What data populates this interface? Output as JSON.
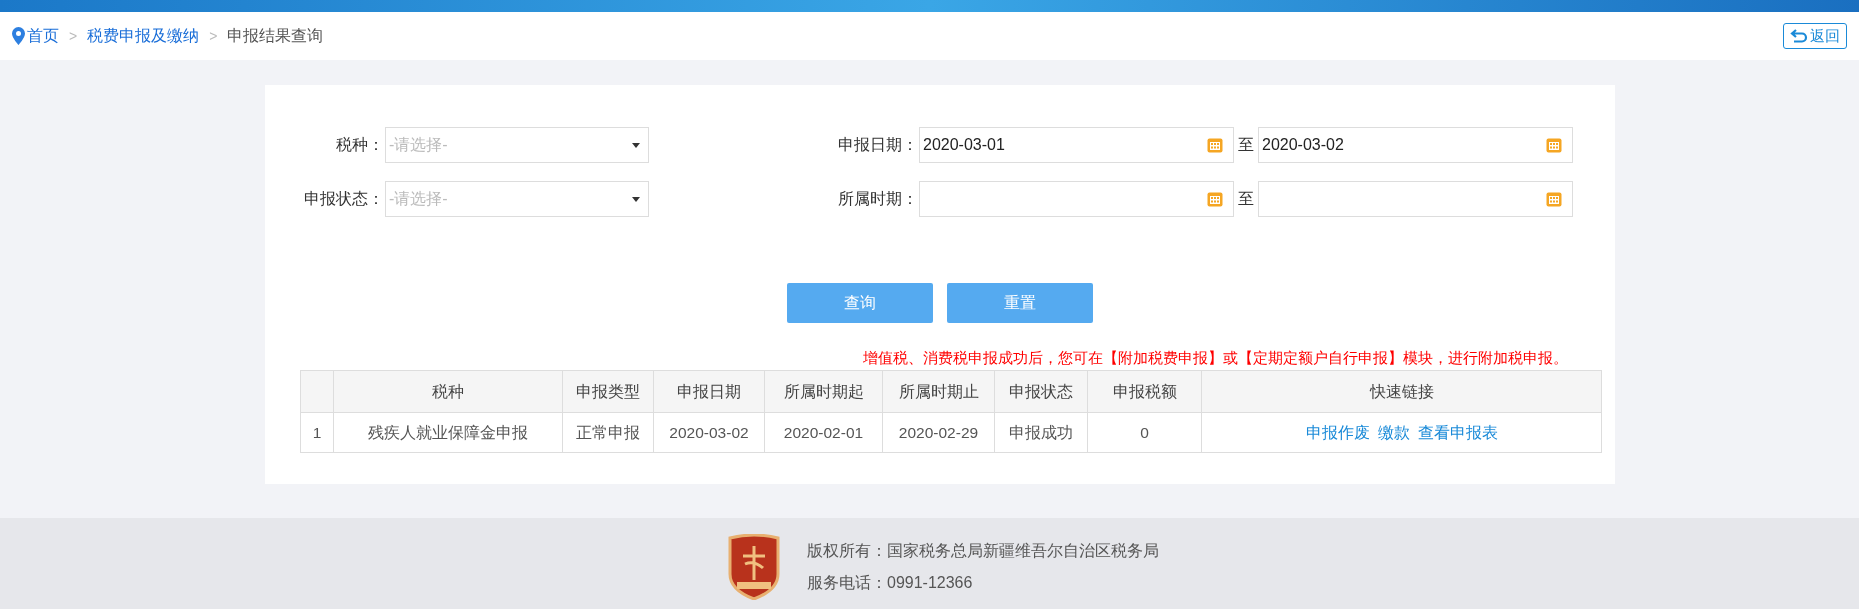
{
  "breadcrumb_separator": ">",
  "breadcrumb": [
    {
      "label": "首页",
      "kind": "home"
    },
    {
      "label": "税费申报及缴纳",
      "kind": "link"
    },
    {
      "label": "申报结果查询",
      "kind": "current"
    }
  ],
  "back_button": "返回",
  "filters": [
    {
      "label": "税种：",
      "kind": "select",
      "placeholder": "-请选择-"
    },
    {
      "label": "申报日期：",
      "kind": "range",
      "from": "2020-03-01",
      "separator": "至",
      "to": "2020-03-02"
    },
    {
      "label": "申报状态：",
      "kind": "select",
      "placeholder": "-请选择-"
    },
    {
      "label": "所属时期：",
      "kind": "range",
      "separator": "至"
    }
  ],
  "buttons": [
    "查询",
    "重置"
  ],
  "notice": "增值税、消费税申报成功后，您可在【附加税费申报】或【定期定额户自行申报】模块，进行附加税申报。",
  "table": {
    "columns": [
      "",
      "税种",
      "申报类型",
      "申报日期",
      "所属时期起",
      "所属时期止",
      "申报状态",
      "申报税额",
      "快速链接"
    ],
    "rows": [
      {
        "cells": [
          "1",
          "残疾人就业保障金申报",
          "正常申报",
          "2020-03-02",
          "2020-02-01",
          "2020-02-29",
          "申报成功",
          "0"
        ],
        "links": [
          "申报作废",
          "缴款",
          "查看申报表"
        ]
      }
    ]
  },
  "footer": {
    "copyright": "版权所有：国家税务总局新疆维吾尔自治区税务局",
    "phone": "服务电话：0991-12366"
  }
}
